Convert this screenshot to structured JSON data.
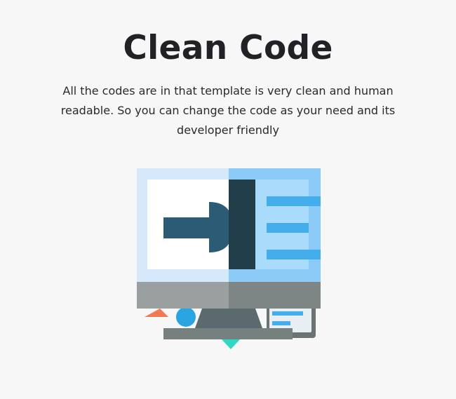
{
  "section": {
    "title": "Clean Code",
    "description": "All the codes are in that template is very clean and human readable. So you can change the code as your need and its developer friendly"
  },
  "illustration": {
    "icon": "monitor-code-illustration",
    "colors": {
      "left_panel": "#d5e9fa",
      "right_panel": "#8ccbf7",
      "screen_white": "#ffffff",
      "screen_blue_light": "#a9dbfb",
      "dark_bar": "#223e4a",
      "handle": "#2b5b75",
      "code_lines": "#44aeec",
      "base_light": "#9aa0a0",
      "base_dark": "#7d8685",
      "stand": "#5a6a6e",
      "foot": "#75807f",
      "accent_orange": "#f27a52",
      "accent_blue": "#29a5e3",
      "accent_teal": "#2fd8c2",
      "card_bg": "#e9eef2",
      "card_border": "#6c7473"
    }
  }
}
